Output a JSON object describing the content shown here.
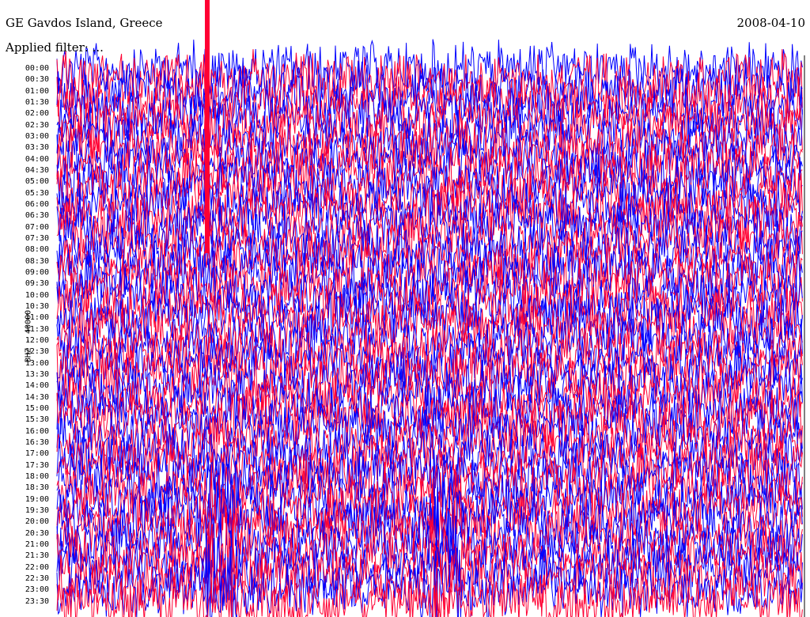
{
  "header": {
    "title": "GE Gavdos Island, Greece",
    "date": "2008-04-10",
    "subtitle": "Applied filter: ..."
  },
  "chart_data": {
    "type": "line",
    "title": "GE Gavdos Island, Greece",
    "date": "2008-04-10",
    "ylabel": "BHZ - 40000",
    "ytick_labels": [
      "00:00",
      "00:30",
      "01:00",
      "01:30",
      "02:00",
      "02:30",
      "03:00",
      "03:30",
      "04:00",
      "04:30",
      "05:00",
      "05:30",
      "06:00",
      "06:30",
      "07:00",
      "07:30",
      "08:00",
      "08:30",
      "09:00",
      "09:30",
      "10:00",
      "10:30",
      "11:00",
      "11:30",
      "12:00",
      "12:30",
      "13:00",
      "13:30",
      "14:00",
      "14:30",
      "15:00",
      "15:30",
      "16:00",
      "16:30",
      "17:00",
      "17:30",
      "18:00",
      "18:30",
      "19:00",
      "19:30",
      "20:00",
      "20:30",
      "21:00",
      "21:30",
      "22:00",
      "22:30",
      "23:00",
      "23:30"
    ],
    "series": [
      {
        "color": "#0000ff"
      },
      {
        "color": "#ff0033"
      }
    ],
    "grid": false,
    "note_events": [
      {
        "row_range": [
          "19:00",
          "23:00"
        ],
        "x_fraction": 0.22
      },
      {
        "row_range": [
          "19:00",
          "23:00"
        ],
        "x_fraction": 0.52
      }
    ]
  }
}
